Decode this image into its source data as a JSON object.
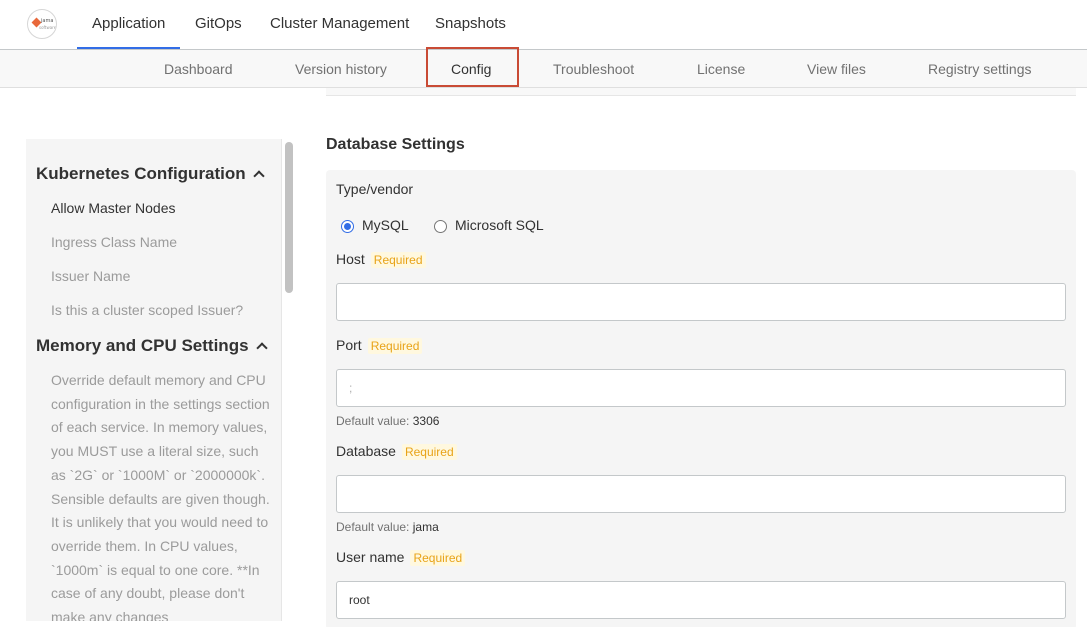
{
  "top_nav": {
    "tabs": [
      {
        "label": "Application",
        "active": true
      },
      {
        "label": "GitOps"
      },
      {
        "label": "Cluster Management"
      },
      {
        "label": "Snapshots"
      }
    ],
    "logo_text_1": "jama",
    "logo_text_2": "software"
  },
  "sub_nav": {
    "items": [
      {
        "label": "Dashboard"
      },
      {
        "label": "Version history"
      },
      {
        "label": "Config",
        "active": true
      },
      {
        "label": "Troubleshoot"
      },
      {
        "label": "License"
      },
      {
        "label": "View files"
      },
      {
        "label": "Registry settings"
      }
    ]
  },
  "sidebar": {
    "section1": {
      "title": "Kubernetes Configuration",
      "items": [
        "Allow Master Nodes",
        "Ingress Class Name",
        "Issuer Name",
        "Is this a cluster scoped Issuer?"
      ]
    },
    "section2": {
      "title": "Memory and CPU Settings",
      "description": "Override default memory and CPU configuration in the settings section of each service. In memory values, you MUST use a literal size, such as `2G` or `1000M` or `2000000k`. Sensible defaults are given though. It is unlikely that you would need to override them. In CPU values, `1000m` is equal to one core. **In case of any doubt, please don't make any changes"
    }
  },
  "main": {
    "title": "Database Settings",
    "type_vendor": {
      "label": "Type/vendor",
      "options": [
        "MySQL",
        "Microsoft SQL"
      ],
      "selected": "MySQL"
    },
    "required_label": "Required",
    "default_prefix": "Default value:",
    "host": {
      "label": "Host",
      "value": ""
    },
    "port": {
      "label": "Port",
      "value": "",
      "placeholder": ";",
      "default": "3306"
    },
    "database": {
      "label": "Database",
      "value": "",
      "default": "jama"
    },
    "username": {
      "label": "User name",
      "value": "root"
    }
  },
  "colors": {
    "accent": "#326de6",
    "highlight": "#c94b35",
    "required": "#e8a318"
  }
}
